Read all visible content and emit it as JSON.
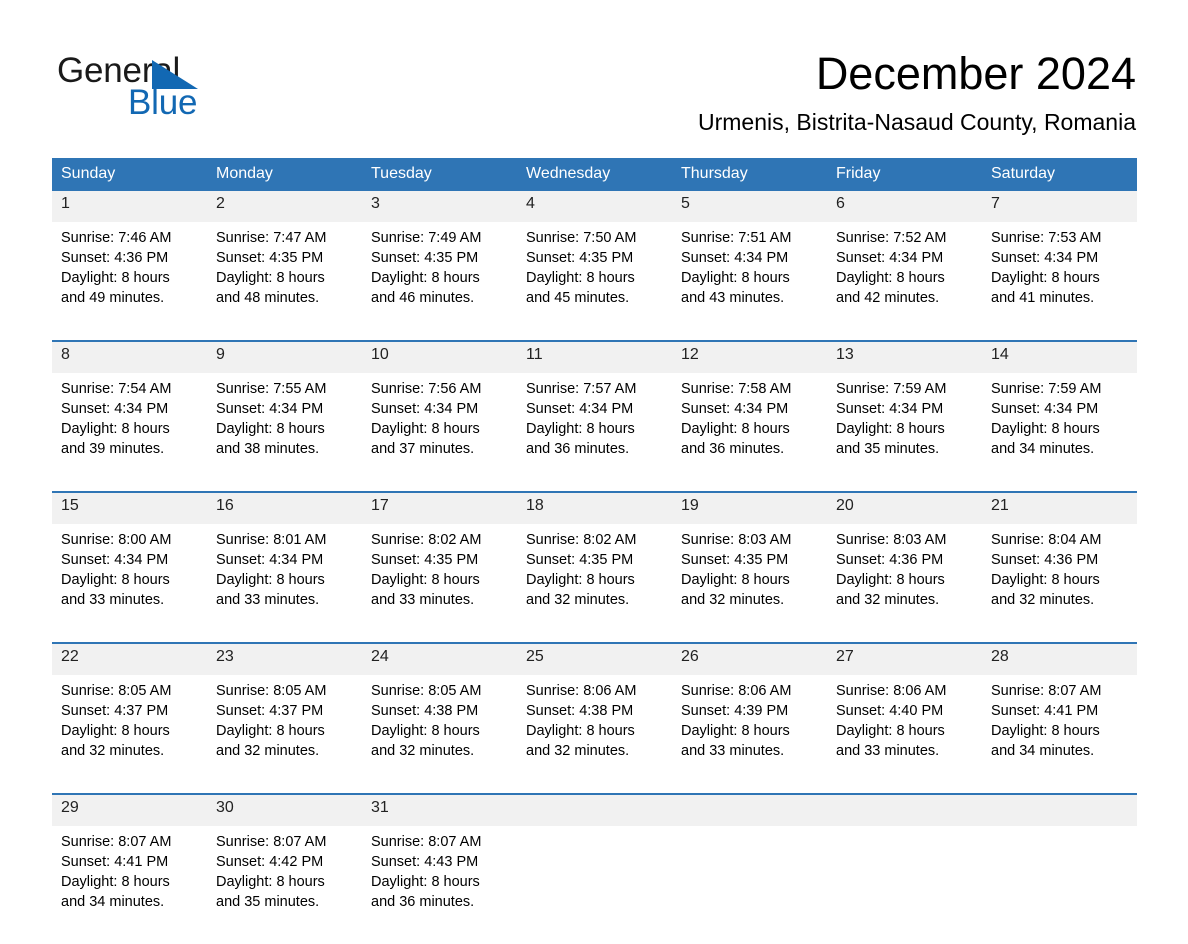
{
  "brand": {
    "name_part1": "General",
    "name_part2": "Blue",
    "triangle_color": "#1268b3",
    "text_color": "#1a1a1a"
  },
  "header": {
    "month_title": "December 2024",
    "location": "Urmenis, Bistrita-Nasaud County, Romania"
  },
  "theme": {
    "header_blue": "#2f75b5",
    "daynum_band": "#f1f1f1",
    "page_background": "#ffffff"
  },
  "calendar": {
    "day_names": [
      "Sunday",
      "Monday",
      "Tuesday",
      "Wednesday",
      "Thursday",
      "Friday",
      "Saturday"
    ],
    "weeks": [
      [
        {
          "day": "1",
          "lines": [
            "Sunrise: 7:46 AM",
            "Sunset: 4:36 PM",
            "Daylight: 8 hours",
            "and 49 minutes."
          ]
        },
        {
          "day": "2",
          "lines": [
            "Sunrise: 7:47 AM",
            "Sunset: 4:35 PM",
            "Daylight: 8 hours",
            "and 48 minutes."
          ]
        },
        {
          "day": "3",
          "lines": [
            "Sunrise: 7:49 AM",
            "Sunset: 4:35 PM",
            "Daylight: 8 hours",
            "and 46 minutes."
          ]
        },
        {
          "day": "4",
          "lines": [
            "Sunrise: 7:50 AM",
            "Sunset: 4:35 PM",
            "Daylight: 8 hours",
            "and 45 minutes."
          ]
        },
        {
          "day": "5",
          "lines": [
            "Sunrise: 7:51 AM",
            "Sunset: 4:34 PM",
            "Daylight: 8 hours",
            "and 43 minutes."
          ]
        },
        {
          "day": "6",
          "lines": [
            "Sunrise: 7:52 AM",
            "Sunset: 4:34 PM",
            "Daylight: 8 hours",
            "and 42 minutes."
          ]
        },
        {
          "day": "7",
          "lines": [
            "Sunrise: 7:53 AM",
            "Sunset: 4:34 PM",
            "Daylight: 8 hours",
            "and 41 minutes."
          ]
        }
      ],
      [
        {
          "day": "8",
          "lines": [
            "Sunrise: 7:54 AM",
            "Sunset: 4:34 PM",
            "Daylight: 8 hours",
            "and 39 minutes."
          ]
        },
        {
          "day": "9",
          "lines": [
            "Sunrise: 7:55 AM",
            "Sunset: 4:34 PM",
            "Daylight: 8 hours",
            "and 38 minutes."
          ]
        },
        {
          "day": "10",
          "lines": [
            "Sunrise: 7:56 AM",
            "Sunset: 4:34 PM",
            "Daylight: 8 hours",
            "and 37 minutes."
          ]
        },
        {
          "day": "11",
          "lines": [
            "Sunrise: 7:57 AM",
            "Sunset: 4:34 PM",
            "Daylight: 8 hours",
            "and 36 minutes."
          ]
        },
        {
          "day": "12",
          "lines": [
            "Sunrise: 7:58 AM",
            "Sunset: 4:34 PM",
            "Daylight: 8 hours",
            "and 36 minutes."
          ]
        },
        {
          "day": "13",
          "lines": [
            "Sunrise: 7:59 AM",
            "Sunset: 4:34 PM",
            "Daylight: 8 hours",
            "and 35 minutes."
          ]
        },
        {
          "day": "14",
          "lines": [
            "Sunrise: 7:59 AM",
            "Sunset: 4:34 PM",
            "Daylight: 8 hours",
            "and 34 minutes."
          ]
        }
      ],
      [
        {
          "day": "15",
          "lines": [
            "Sunrise: 8:00 AM",
            "Sunset: 4:34 PM",
            "Daylight: 8 hours",
            "and 33 minutes."
          ]
        },
        {
          "day": "16",
          "lines": [
            "Sunrise: 8:01 AM",
            "Sunset: 4:34 PM",
            "Daylight: 8 hours",
            "and 33 minutes."
          ]
        },
        {
          "day": "17",
          "lines": [
            "Sunrise: 8:02 AM",
            "Sunset: 4:35 PM",
            "Daylight: 8 hours",
            "and 33 minutes."
          ]
        },
        {
          "day": "18",
          "lines": [
            "Sunrise: 8:02 AM",
            "Sunset: 4:35 PM",
            "Daylight: 8 hours",
            "and 32 minutes."
          ]
        },
        {
          "day": "19",
          "lines": [
            "Sunrise: 8:03 AM",
            "Sunset: 4:35 PM",
            "Daylight: 8 hours",
            "and 32 minutes."
          ]
        },
        {
          "day": "20",
          "lines": [
            "Sunrise: 8:03 AM",
            "Sunset: 4:36 PM",
            "Daylight: 8 hours",
            "and 32 minutes."
          ]
        },
        {
          "day": "21",
          "lines": [
            "Sunrise: 8:04 AM",
            "Sunset: 4:36 PM",
            "Daylight: 8 hours",
            "and 32 minutes."
          ]
        }
      ],
      [
        {
          "day": "22",
          "lines": [
            "Sunrise: 8:05 AM",
            "Sunset: 4:37 PM",
            "Daylight: 8 hours",
            "and 32 minutes."
          ]
        },
        {
          "day": "23",
          "lines": [
            "Sunrise: 8:05 AM",
            "Sunset: 4:37 PM",
            "Daylight: 8 hours",
            "and 32 minutes."
          ]
        },
        {
          "day": "24",
          "lines": [
            "Sunrise: 8:05 AM",
            "Sunset: 4:38 PM",
            "Daylight: 8 hours",
            "and 32 minutes."
          ]
        },
        {
          "day": "25",
          "lines": [
            "Sunrise: 8:06 AM",
            "Sunset: 4:38 PM",
            "Daylight: 8 hours",
            "and 32 minutes."
          ]
        },
        {
          "day": "26",
          "lines": [
            "Sunrise: 8:06 AM",
            "Sunset: 4:39 PM",
            "Daylight: 8 hours",
            "and 33 minutes."
          ]
        },
        {
          "day": "27",
          "lines": [
            "Sunrise: 8:06 AM",
            "Sunset: 4:40 PM",
            "Daylight: 8 hours",
            "and 33 minutes."
          ]
        },
        {
          "day": "28",
          "lines": [
            "Sunrise: 8:07 AM",
            "Sunset: 4:41 PM",
            "Daylight: 8 hours",
            "and 34 minutes."
          ]
        }
      ],
      [
        {
          "day": "29",
          "lines": [
            "Sunrise: 8:07 AM",
            "Sunset: 4:41 PM",
            "Daylight: 8 hours",
            "and 34 minutes."
          ]
        },
        {
          "day": "30",
          "lines": [
            "Sunrise: 8:07 AM",
            "Sunset: 4:42 PM",
            "Daylight: 8 hours",
            "and 35 minutes."
          ]
        },
        {
          "day": "31",
          "lines": [
            "Sunrise: 8:07 AM",
            "Sunset: 4:43 PM",
            "Daylight: 8 hours",
            "and 36 minutes."
          ]
        },
        {
          "day": "",
          "lines": []
        },
        {
          "day": "",
          "lines": []
        },
        {
          "day": "",
          "lines": []
        },
        {
          "day": "",
          "lines": []
        }
      ]
    ]
  }
}
